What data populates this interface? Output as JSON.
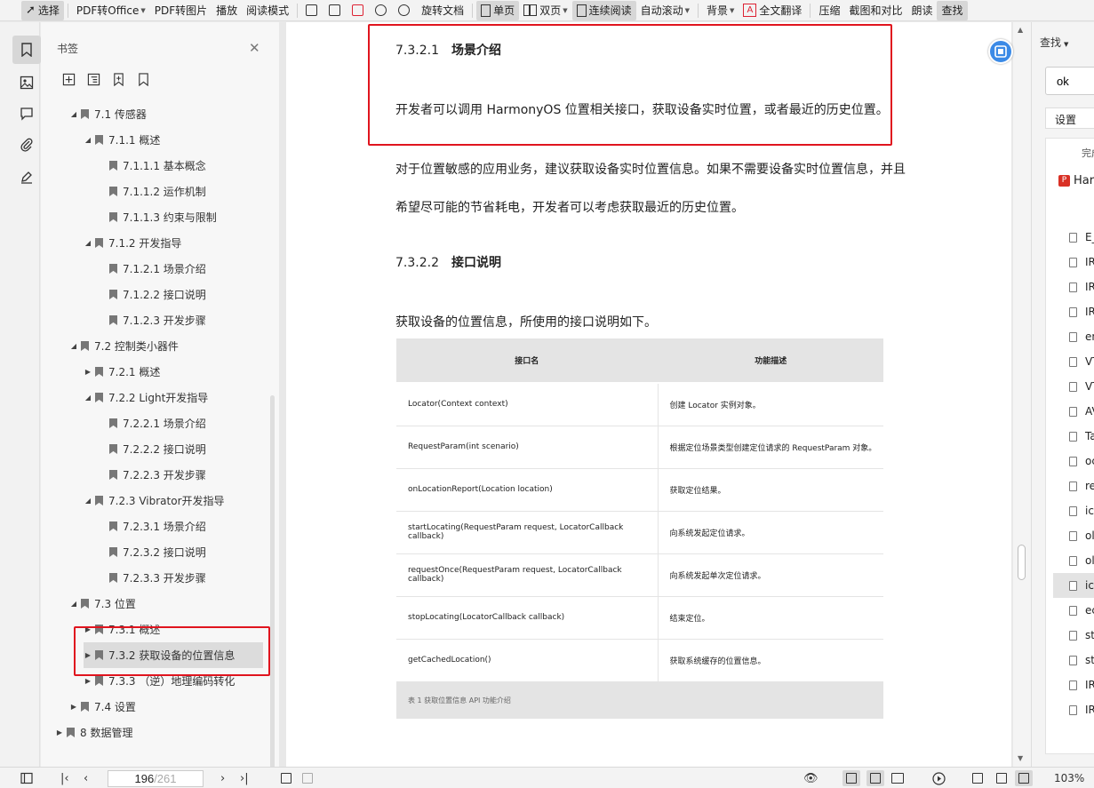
{
  "toolbar": {
    "items": [
      {
        "label": "选择",
        "active": true
      },
      {
        "label": "PDF转Office"
      },
      {
        "label": "PDF转图片"
      },
      {
        "label": "播放"
      },
      {
        "label": "阅读模式"
      },
      {
        "label": "旋转文档"
      },
      {
        "label": "单页",
        "active": true
      },
      {
        "label": "双页"
      },
      {
        "label": "连续阅读",
        "active": true
      },
      {
        "label": "自动滚动"
      },
      {
        "label": "背景"
      },
      {
        "label": "全文翻译"
      },
      {
        "label": "压缩"
      },
      {
        "label": "截图和对比"
      },
      {
        "label": "朗读"
      },
      {
        "label": "查找",
        "active": true
      }
    ]
  },
  "bookmarks": {
    "title": "书签",
    "items": [
      {
        "label": "7.1 传感器",
        "level": 1,
        "expander": "open"
      },
      {
        "label": "7.1.1 概述",
        "level": 2,
        "expander": "open"
      },
      {
        "label": "7.1.1.1 基本概念",
        "level": 3,
        "expander": "none"
      },
      {
        "label": "7.1.1.2 运作机制",
        "level": 3,
        "expander": "none"
      },
      {
        "label": "7.1.1.3 约束与限制",
        "level": 3,
        "expander": "none"
      },
      {
        "label": "7.1.2 开发指导",
        "level": 2,
        "expander": "open"
      },
      {
        "label": "7.1.2.1 场景介绍",
        "level": 3,
        "expander": "none"
      },
      {
        "label": "7.1.2.2 接口说明",
        "level": 3,
        "expander": "none"
      },
      {
        "label": "7.1.2.3 开发步骤",
        "level": 3,
        "expander": "none"
      },
      {
        "label": "7.2 控制类小器件",
        "level": 1,
        "expander": "open"
      },
      {
        "label": "7.2.1 概述",
        "level": 2,
        "expander": "closed"
      },
      {
        "label": "7.2.2 Light开发指导",
        "level": 2,
        "expander": "open"
      },
      {
        "label": "7.2.2.1 场景介绍",
        "level": 3,
        "expander": "none"
      },
      {
        "label": "7.2.2.2 接口说明",
        "level": 3,
        "expander": "none"
      },
      {
        "label": "7.2.2.3 开发步骤",
        "level": 3,
        "expander": "none"
      },
      {
        "label": "7.2.3 Vibrator开发指导",
        "level": 2,
        "expander": "open"
      },
      {
        "label": "7.2.3.1 场景介绍",
        "level": 3,
        "expander": "none"
      },
      {
        "label": "7.2.3.2 接口说明",
        "level": 3,
        "expander": "none"
      },
      {
        "label": "7.2.3.3 开发步骤",
        "level": 3,
        "expander": "none"
      },
      {
        "label": "7.3 位置",
        "level": 1,
        "expander": "open"
      },
      {
        "label": "7.3.1 概述",
        "level": 2,
        "expander": "closed"
      },
      {
        "label": "7.3.2 获取设备的位置信息",
        "level": 2,
        "expander": "closed",
        "selected": true
      },
      {
        "label": "7.3.3 （逆）地理编码转化",
        "level": 2,
        "expander": "closed"
      },
      {
        "label": "7.4 设置",
        "level": 1,
        "expander": "closed"
      },
      {
        "label": "8 数据管理",
        "level": 0,
        "expander": "closed"
      }
    ]
  },
  "document": {
    "section1_num": "7.3.2.1",
    "section1_title": "场景介绍",
    "para1": "开发者可以调用 HarmonyOS 位置相关接口，获取设备实时位置，或者最近的历史位置。",
    "para2a": "对于位置敏感的应用业务，建议获取设备实时位置信息。如果不需要设备实时位置信息，并且",
    "para2b": "希望尽可能的节省耗电，开发者可以考虑获取最近的历史位置。",
    "section2_num": "7.3.2.2",
    "section2_title": "接口说明",
    "para3": "获取设备的位置信息，所使用的接口说明如下。",
    "table": {
      "headers": [
        "接口名",
        "功能描述"
      ],
      "rows": [
        [
          "Locator(Context context)",
          "创建 Locator 实例对象。"
        ],
        [
          "RequestParam(int scenario)",
          "根据定位场景类型创建定位请求的 RequestParam 对象。"
        ],
        [
          "onLocationReport(Location location)",
          "获取定位结果。"
        ],
        [
          "startLocating(RequestParam request, LocatorCallback callback)",
          "向系统发起定位请求。"
        ],
        [
          "requestOnce(RequestParam request, LocatorCallback callback)",
          "向系统发起单次定位请求。"
        ],
        [
          "stopLocating(LocatorCallback callback)",
          "结束定位。"
        ],
        [
          "getCachedLocation()",
          "获取系统缓存的位置信息。"
        ]
      ],
      "caption": "表 1 获取位置信息 API 功能介绍"
    }
  },
  "find": {
    "title": "查找",
    "query": "ok",
    "settings": "设置",
    "done_label": "完成",
    "doc_name": "Harm",
    "results": [
      "E_",
      "IR",
      "IR",
      "IR",
      "en",
      "VT",
      "VT",
      "AV",
      "Ta",
      "oc",
      "re",
      "ic",
      "ol",
      "ol",
      "ic",
      "ec",
      "st",
      "st",
      "IR",
      "IR"
    ],
    "selected_index": 14
  },
  "status": {
    "current_page": "196",
    "total_pages": "/261",
    "zoom": "103%"
  },
  "colors": {
    "highlight_border": "#e0141e",
    "accent_blue": "#3b8ae6"
  }
}
